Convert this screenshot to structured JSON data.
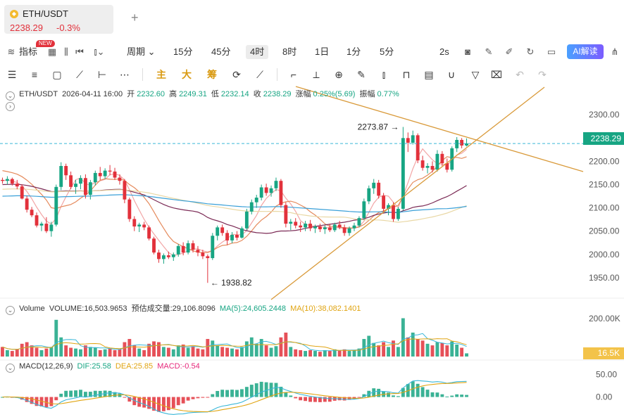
{
  "tab": {
    "symbol": "ETH/USDT",
    "price": "2238.29",
    "change": "-0.3%"
  },
  "toolbar": {
    "indicators_label": "指标",
    "new_badge": "NEW",
    "period_label": "周期",
    "intervals": [
      "15分",
      "45分",
      "4时",
      "8时",
      "1日",
      "1分",
      "5分"
    ],
    "active_interval": "4时",
    "sec_label": "2s",
    "ai_label": "AI解读"
  },
  "drawing_toolbar": {
    "zhu": "主",
    "da": "大",
    "chou": "筹"
  },
  "legend": {
    "symbol": "ETH/USDT",
    "datetime": "2026-04-11 16:00",
    "open_label": "开",
    "open": "2232.60",
    "high_label": "高",
    "high": "2249.31",
    "low_label": "低",
    "low": "2232.14",
    "close_label": "收",
    "close": "2238.29",
    "change_label": "涨幅",
    "change": "0.25%(5.69)",
    "amplitude_label": "振幅",
    "amplitude": "0.77%"
  },
  "volume_legend": {
    "label": "Volume",
    "volume": "VOLUME:16,503.9653",
    "est": "预估成交量:29,106.8096",
    "ma5": "MA(5):24,605.2448",
    "ma10": "MA(10):38,082.1401"
  },
  "macd_legend": {
    "label": "MACD(12,26,9)",
    "dif": "DIF:25.58",
    "dea": "DEA:25.85",
    "macd": "MACD:-0.54"
  },
  "colors": {
    "up": "#17a583",
    "down": "#e2313b",
    "ma_a": "#f2a6a6",
    "ma_b": "#e58a5c",
    "ma_c": "#7b2a55",
    "ma_d": "#e9d8a6",
    "ma_e": "#3aa0d8",
    "trendline": "#d99a3a",
    "dif": "#3ab7d8",
    "dea": "#e0a411"
  },
  "chart_data": [
    {
      "type": "candlestick",
      "title": "ETH/USDT 4时",
      "y_ticks": [
        2300,
        2250,
        2200,
        2150,
        2100,
        2050,
        2000,
        1950
      ],
      "y_tick_labels": [
        "2300.00",
        "2250.00",
        "2200.00",
        "2150.00",
        "2100.00",
        "2050.00",
        "2000.00",
        "1950.00"
      ],
      "ylim": [
        1915,
        2320
      ],
      "last_price": 2238.29,
      "last_price_label": "2238.29",
      "annotations": [
        {
          "label": "2273.87",
          "value": 2273.87,
          "kind": "high"
        },
        {
          "label": "1938.82",
          "value": 1938.82,
          "kind": "low"
        }
      ],
      "ohlc": [
        [
          2160,
          2165,
          2152,
          2158
        ],
        [
          2158,
          2168,
          2150,
          2162
        ],
        [
          2162,
          2165,
          2148,
          2152
        ],
        [
          2152,
          2160,
          2140,
          2146
        ],
        [
          2146,
          2150,
          2118,
          2120
        ],
        [
          2120,
          2126,
          2090,
          2096
        ],
        [
          2096,
          2102,
          2080,
          2084
        ],
        [
          2084,
          2090,
          2058,
          2062
        ],
        [
          2062,
          2070,
          2050,
          2066
        ],
        [
          2066,
          2080,
          2046,
          2050
        ],
        [
          2050,
          2070,
          2038,
          2064
        ],
        [
          2064,
          2150,
          2060,
          2145
        ],
        [
          2145,
          2198,
          2138,
          2190
        ],
        [
          2190,
          2195,
          2160,
          2170
        ],
        [
          2170,
          2178,
          2140,
          2145
        ],
        [
          2145,
          2160,
          2130,
          2152
        ],
        [
          2152,
          2170,
          2140,
          2164
        ],
        [
          2164,
          2172,
          2120,
          2128
        ],
        [
          2128,
          2160,
          2118,
          2155
        ],
        [
          2155,
          2180,
          2148,
          2175
        ],
        [
          2175,
          2188,
          2160,
          2168
        ],
        [
          2168,
          2185,
          2162,
          2180
        ],
        [
          2180,
          2192,
          2170,
          2178
        ],
        [
          2178,
          2186,
          2160,
          2165
        ],
        [
          2165,
          2172,
          2150,
          2158
        ],
        [
          2158,
          2162,
          2110,
          2118
        ],
        [
          2118,
          2122,
          2070,
          2076
        ],
        [
          2076,
          2082,
          2050,
          2060
        ],
        [
          2060,
          2068,
          2048,
          2064
        ],
        [
          2064,
          2070,
          2052,
          2058
        ],
        [
          2058,
          2062,
          2030,
          2034
        ],
        [
          2034,
          2038,
          2000,
          2004
        ],
        [
          2004,
          2010,
          1982,
          1990
        ],
        [
          1990,
          2002,
          1980,
          1998
        ],
        [
          1998,
          2006,
          1990,
          1994
        ],
        [
          1994,
          2004,
          1986,
          2000
        ],
        [
          2000,
          2022,
          1995,
          2018
        ],
        [
          2018,
          2026,
          1998,
          2004
        ],
        [
          2004,
          2030,
          2000,
          2024
        ],
        [
          2024,
          2030,
          2004,
          2010
        ],
        [
          2010,
          2018,
          1996,
          2004
        ],
        [
          2004,
          2010,
          1990,
          1996
        ],
        [
          1996,
          2000,
          1938.82,
          1992
        ],
        [
          1992,
          2046,
          1988,
          2040
        ],
        [
          2040,
          2062,
          2030,
          2058
        ],
        [
          2058,
          2064,
          2040,
          2046
        ],
        [
          2046,
          2052,
          2020,
          2030
        ],
        [
          2030,
          2048,
          2024,
          2042
        ],
        [
          2042,
          2050,
          2030,
          2036
        ],
        [
          2036,
          2060,
          2034,
          2056
        ],
        [
          2056,
          2098,
          2052,
          2092
        ],
        [
          2092,
          2118,
          2086,
          2112
        ],
        [
          2112,
          2128,
          2100,
          2122
        ],
        [
          2122,
          2150,
          2116,
          2144
        ],
        [
          2144,
          2152,
          2126,
          2132
        ],
        [
          2132,
          2148,
          2124,
          2142
        ],
        [
          2142,
          2165,
          2136,
          2158
        ],
        [
          2158,
          2162,
          2100,
          2106
        ],
        [
          2106,
          2112,
          2058,
          2066
        ],
        [
          2066,
          2076,
          2052,
          2070
        ],
        [
          2070,
          2078,
          2056,
          2062
        ],
        [
          2062,
          2070,
          2048,
          2058
        ],
        [
          2058,
          2072,
          2050,
          2066
        ],
        [
          2066,
          2074,
          2050,
          2056
        ],
        [
          2056,
          2064,
          2046,
          2060
        ],
        [
          2060,
          2066,
          2048,
          2054
        ],
        [
          2054,
          2062,
          2044,
          2058
        ],
        [
          2058,
          2066,
          2048,
          2052
        ],
        [
          2052,
          2068,
          2048,
          2064
        ],
        [
          2064,
          2072,
          2054,
          2058
        ],
        [
          2058,
          2064,
          2040,
          2046
        ],
        [
          2046,
          2060,
          2040,
          2056
        ],
        [
          2056,
          2068,
          2050,
          2062
        ],
        [
          2062,
          2082,
          2058,
          2078
        ],
        [
          2078,
          2120,
          2074,
          2114
        ],
        [
          2114,
          2148,
          2108,
          2142
        ],
        [
          2142,
          2162,
          2130,
          2154
        ],
        [
          2154,
          2160,
          2120,
          2126
        ],
        [
          2126,
          2132,
          2092,
          2098
        ],
        [
          2098,
          2110,
          2084,
          2106
        ],
        [
          2106,
          2112,
          2070,
          2076
        ],
        [
          2076,
          2102,
          2072,
          2098
        ],
        [
          2098,
          2273.87,
          2094,
          2250
        ],
        [
          2250,
          2262,
          2220,
          2240
        ],
        [
          2240,
          2266,
          2236,
          2256
        ],
        [
          2256,
          2260,
          2196,
          2202
        ],
        [
          2202,
          2212,
          2180,
          2186
        ],
        [
          2186,
          2196,
          2174,
          2190
        ],
        [
          2190,
          2200,
          2176,
          2182
        ],
        [
          2182,
          2224,
          2178,
          2216
        ],
        [
          2216,
          2222,
          2190,
          2196
        ],
        [
          2196,
          2206,
          2176,
          2182
        ],
        [
          2182,
          2232,
          2178,
          2228
        ],
        [
          2228,
          2252,
          2220,
          2246
        ],
        [
          2246,
          2250,
          2228,
          2234
        ],
        [
          2234,
          2249.31,
          2232,
          2238.29
        ]
      ],
      "volume": {
        "ylim": [
          0,
          260
        ],
        "y_tick_label": "200.00K",
        "last_label": "16.5K",
        "values": [
          60,
          40,
          35,
          45,
          80,
          90,
          70,
          55,
          40,
          50,
          60,
          230,
          120,
          70,
          55,
          50,
          45,
          70,
          60,
          55,
          40,
          45,
          50,
          40,
          45,
          90,
          110,
          70,
          50,
          40,
          80,
          95,
          90,
          60,
          55,
          45,
          70,
          75,
          55,
          65,
          50,
          45,
          110,
          100,
          70,
          60,
          55,
          50,
          45,
          60,
          95,
          120,
          80,
          110,
          70,
          55,
          65,
          120,
          150,
          60,
          45,
          40,
          35,
          40,
          35,
          30,
          40,
          35,
          45,
          40,
          45,
          35,
          40,
          50,
          110,
          130,
          85,
          70,
          90,
          60,
          100,
          60,
          240,
          120,
          150,
          110,
          100,
          80,
          70,
          90,
          85,
          70,
          95,
          75,
          55,
          20
        ]
      },
      "macd": {
        "y_tick_labels": [
          "50.00",
          "0.00"
        ],
        "ylim": [
          -40,
          70
        ],
        "dif": 25.58,
        "dea": 25.85,
        "macd": -0.54
      }
    }
  ]
}
